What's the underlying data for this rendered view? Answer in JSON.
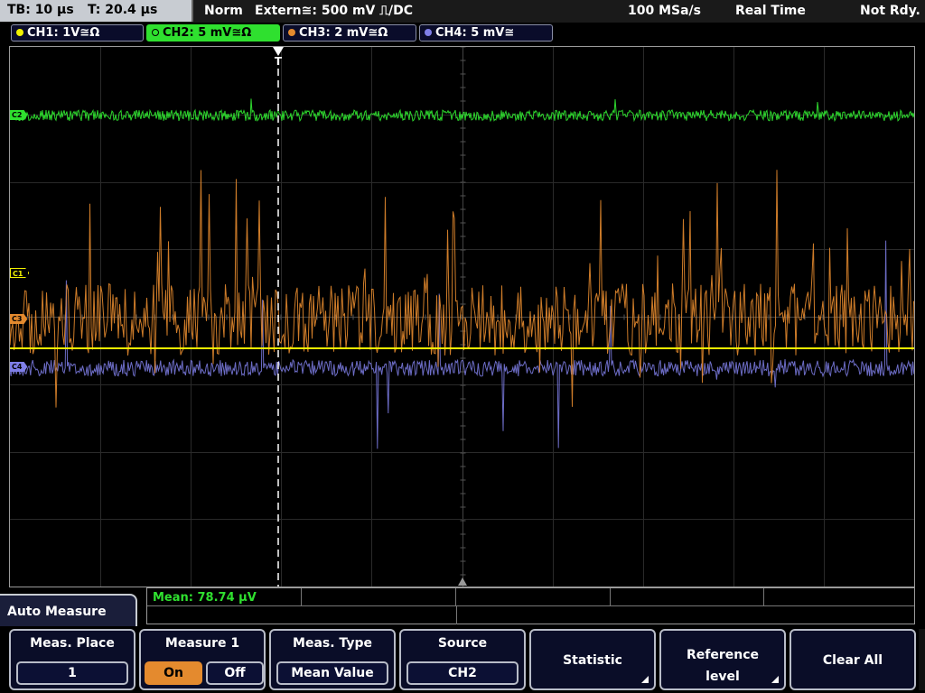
{
  "status": {
    "timebase": "TB: 10 µs",
    "trigger_time": "T: 20.4 µs",
    "trigger_mode": "Norm",
    "trigger_source": "Extern≅: 500 mV ⎍/DC",
    "sample_rate": "100 MSa/s",
    "acq_mode": "Real Time",
    "state": "Not Rdy."
  },
  "channels": [
    {
      "label": "CH1: 1V≅Ω",
      "color": "#f2f200",
      "active": false
    },
    {
      "label": "CH2: 5 mV≅Ω",
      "color": "#2fe02f",
      "active": true
    },
    {
      "label": "CH3: 2 mV≅Ω",
      "color": "#e48a2e",
      "active": false
    },
    {
      "label": "CH4: 5 mV≅",
      "color": "#7f7fe8",
      "active": false
    }
  ],
  "markers": {
    "c2": "C2",
    "c1": "C1",
    "c3": "C3",
    "c4": "C4",
    "trigger": "T"
  },
  "measurement": {
    "mean_readout": "Mean: 78.74 µV"
  },
  "menu": {
    "title": "Auto Measure",
    "meas_place": {
      "label": "Meas. Place",
      "value": "1"
    },
    "measure1": {
      "label": "Measure 1",
      "on": "On",
      "off": "Off",
      "selected": "On"
    },
    "meas_type": {
      "label": "Meas. Type",
      "value": "Mean Value"
    },
    "source": {
      "label": "Source",
      "value": "CH2"
    },
    "statistic": {
      "label": "Statistic"
    },
    "reference_level": {
      "line1": "Reference",
      "line2": "level"
    },
    "clear_all": {
      "label": "Clear All"
    }
  }
}
